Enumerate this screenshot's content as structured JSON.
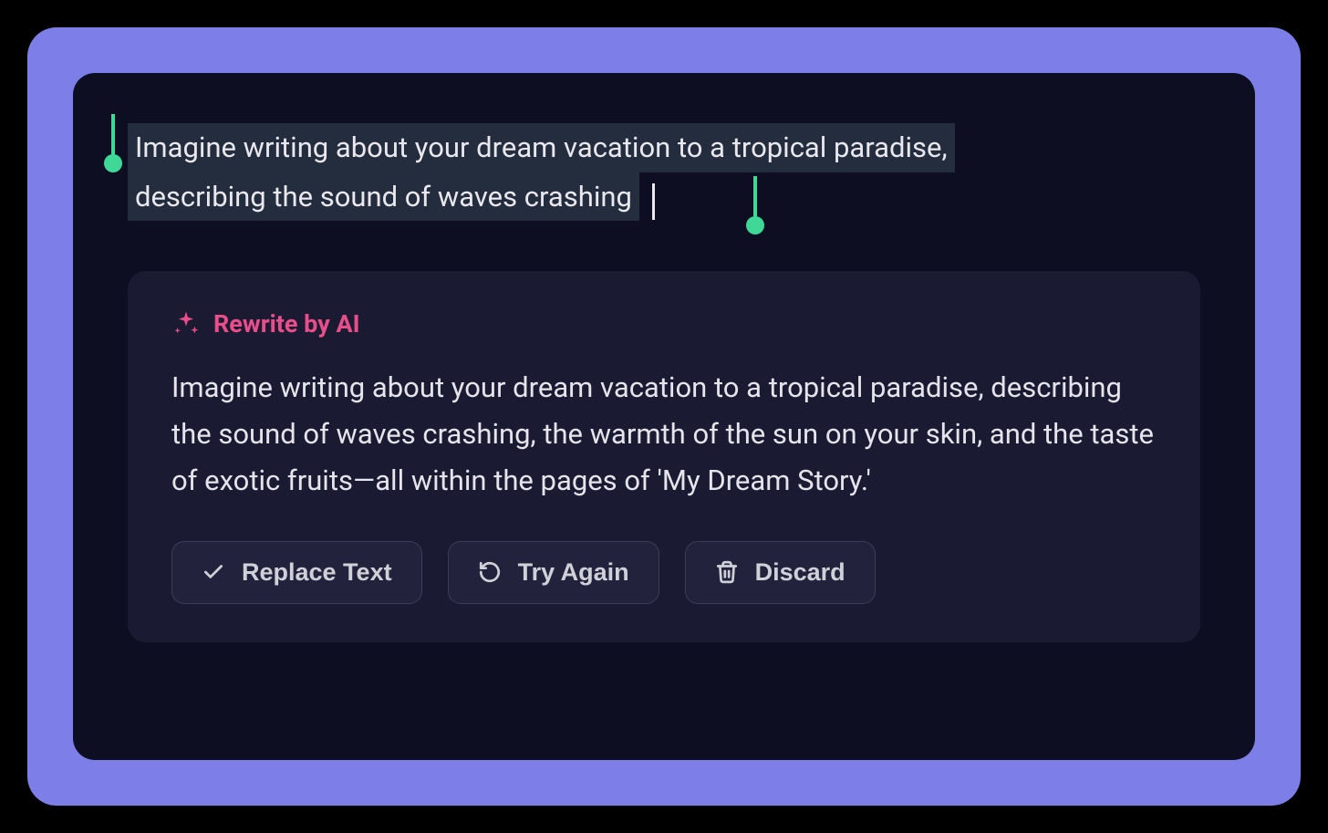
{
  "colors": {
    "outer_bg": "#7e7ee8",
    "panel_bg": "#0d0e22",
    "card_bg": "#1b1a33",
    "accent": "#e84f8a",
    "selection_handle": "#3fd896"
  },
  "selected_text": {
    "line1": "Imagine writing about your dream vacation to a tropical paradise,",
    "line2": "describing the sound of waves crashing"
  },
  "ai_panel": {
    "title": "Rewrite by AI",
    "body": "Imagine writing about your dream vacation to a tropical paradise, describing the sound of waves crashing, the warmth of the sun on your skin, and the taste of exotic fruits—all within the pages of 'My Dream Story.'"
  },
  "buttons": {
    "replace": "Replace Text",
    "try_again": "Try Again",
    "discard": "Discard"
  },
  "icons": {
    "sparkle": "sparkle-icon",
    "check": "check-icon",
    "refresh": "refresh-icon",
    "trash": "trash-icon"
  }
}
